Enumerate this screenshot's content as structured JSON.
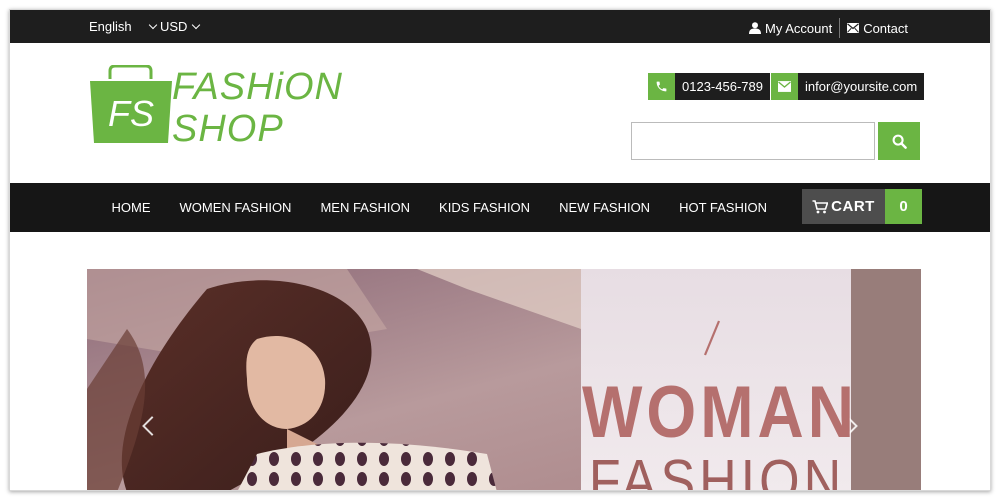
{
  "topbar": {
    "language": "English",
    "currency": "USD",
    "account_label": "My Account",
    "contact_label": "Contact"
  },
  "header": {
    "logo": {
      "monogram": "FS",
      "line1": "FASHiON",
      "line2": "SHOP"
    },
    "phone": "0123-456-789",
    "email": "infor@yoursite.com",
    "search": {
      "value": "",
      "placeholder": ""
    }
  },
  "nav": {
    "items": [
      "HOME",
      "WOMEN FASHION",
      "MEN FASHION",
      "KIDS FASHION",
      "NEW FASHION",
      "HOT FASHION"
    ],
    "cart_label": "CART",
    "cart_count": "0"
  },
  "slider": {
    "headline": "WOMAN",
    "subheadline": "FASHION"
  },
  "colors": {
    "accent": "#6bb543",
    "dark": "#1e1e1e",
    "headline": "#b5706e"
  }
}
